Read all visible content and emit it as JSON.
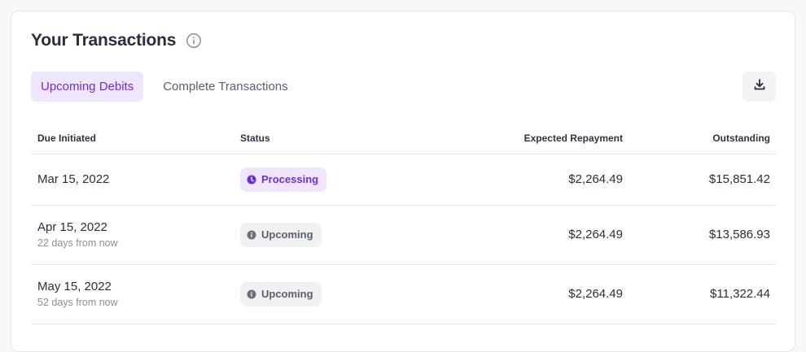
{
  "header": {
    "title": "Your Transactions",
    "info_icon": "info-icon"
  },
  "tabs": [
    {
      "label": "Upcoming Debits",
      "active": true
    },
    {
      "label": "Complete Transactions",
      "active": false
    }
  ],
  "toolbar": {
    "download_icon": "download-icon"
  },
  "table": {
    "columns": {
      "due": "Due Initiated",
      "status": "Status",
      "expected": "Expected Repayment",
      "outstanding": "Outstanding"
    },
    "rows": [
      {
        "date": "Mar 15, 2022",
        "sub": "",
        "status": "Processing",
        "status_icon": "clock-icon",
        "expected": "$2,264.49",
        "outstanding": "$15,851.42"
      },
      {
        "date": "Apr 15, 2022",
        "sub": "22 days from now",
        "status": "Upcoming",
        "status_icon": "info-icon",
        "expected": "$2,264.49",
        "outstanding": "$13,586.93"
      },
      {
        "date": "May 15, 2022",
        "sub": "52 days from now",
        "status": "Upcoming",
        "status_icon": "info-icon",
        "expected": "$2,264.49",
        "outstanding": "$11,322.44"
      }
    ]
  },
  "colors": {
    "accent": "#6b2fd6",
    "accent_bg": "#efe6fd",
    "muted_badge_bg": "#f0f1f3"
  }
}
